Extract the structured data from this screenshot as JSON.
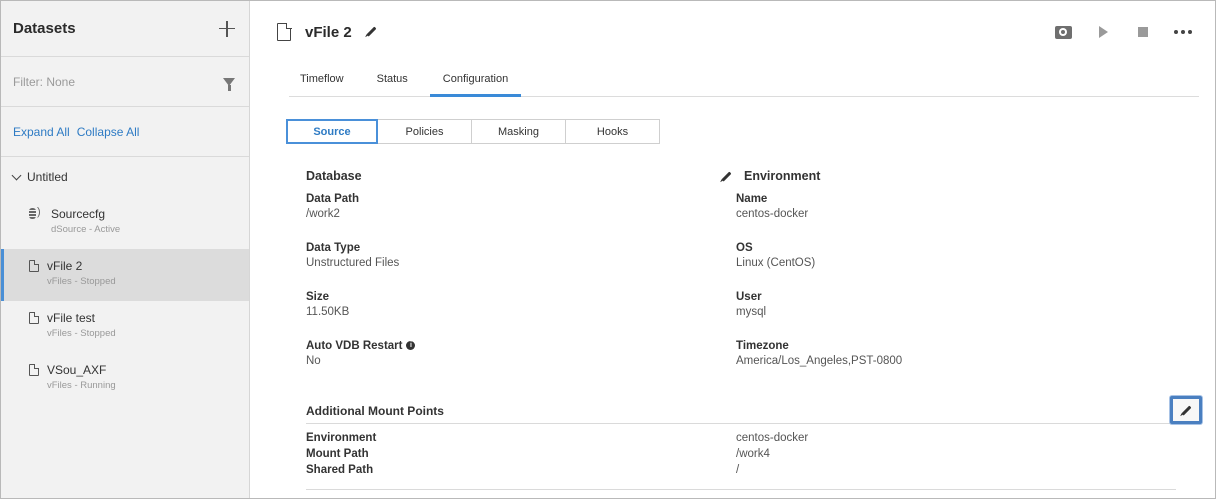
{
  "sidebar": {
    "title": "Datasets",
    "filter_label": "Filter: None",
    "expand_all": "Expand All",
    "collapse_all": "Collapse All",
    "group": "Untitled",
    "items": [
      {
        "name": "Sourcecfg",
        "sub": "dSource - Active",
        "icon": "database-icon"
      },
      {
        "name": "vFile 2",
        "sub": "vFiles - Stopped",
        "icon": "file-icon",
        "active": true
      },
      {
        "name": "vFile test",
        "sub": "vFiles - Stopped",
        "icon": "file-icon"
      },
      {
        "name": "VSou_AXF",
        "sub": "vFiles - Running",
        "icon": "file-icon"
      }
    ]
  },
  "header": {
    "title": "vFile 2",
    "tabs": [
      "Timeflow",
      "Status",
      "Configuration"
    ],
    "active_tab": "Configuration"
  },
  "subtabs": {
    "items": [
      "Source",
      "Policies",
      "Masking",
      "Hooks"
    ],
    "active": "Source"
  },
  "database": {
    "title": "Database",
    "fields": [
      {
        "label": "Data Path",
        "value": "/work2"
      },
      {
        "label": "Data Type",
        "value": "Unstructured Files"
      },
      {
        "label": "Size",
        "value": "11.50KB"
      },
      {
        "label": "Auto VDB Restart",
        "value": "No"
      }
    ]
  },
  "environment": {
    "title": "Environment",
    "fields": [
      {
        "label": "Name",
        "value": "centos-docker"
      },
      {
        "label": "OS",
        "value": "Linux (CentOS)"
      },
      {
        "label": "User",
        "value": "mysql"
      },
      {
        "label": "Timezone",
        "value": "America/Los_Angeles,PST-0800"
      }
    ]
  },
  "mount_points": {
    "title": "Additional Mount Points",
    "rows": [
      {
        "label": "Environment",
        "value": "centos-docker"
      },
      {
        "label": "Mount Path",
        "value": "/work4"
      },
      {
        "label": "Shared Path",
        "value": "/"
      }
    ]
  },
  "colors": {
    "accent": "#3a8ad8",
    "sidebar_bg": "#f2f2f2",
    "active_item_bg": "#dcdcdc"
  }
}
